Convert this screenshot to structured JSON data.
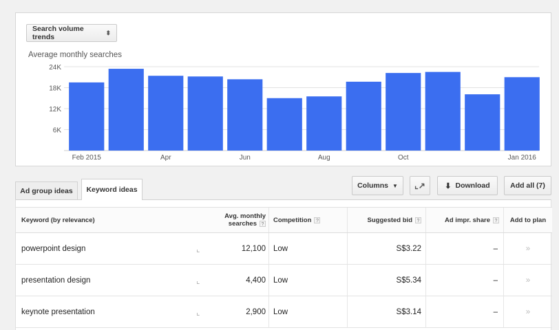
{
  "trend_selector": {
    "label": "Search volume trends",
    "icon": "up-down-arrows-icon"
  },
  "chart_data": {
    "type": "bar",
    "title": "Average monthly searches",
    "categories": [
      "Feb 2015",
      "Mar 2015",
      "Apr 2015",
      "May 2015",
      "Jun 2015",
      "Jul 2015",
      "Aug 2015",
      "Sep 2015",
      "Oct 2015",
      "Nov 2015",
      "Dec 2015",
      "Jan 2016"
    ],
    "x_tick_labels": [
      "Feb 2015",
      "",
      "Apr",
      "",
      "Jun",
      "",
      "Aug",
      "",
      "Oct",
      "",
      "",
      "Jan 2016"
    ],
    "values": [
      19500,
      23400,
      21400,
      21200,
      20400,
      15000,
      15500,
      19700,
      22200,
      22500,
      16100,
      21000
    ],
    "ylim": [
      0,
      24000
    ],
    "y_ticks": [
      6000,
      12000,
      18000,
      24000
    ],
    "y_tick_labels": [
      "6K",
      "12K",
      "18K",
      "24K"
    ],
    "bar_color": "#3b6ef0",
    "grid": true
  },
  "tabs": [
    {
      "label": "Ad group ideas",
      "active": false
    },
    {
      "label": "Keyword ideas",
      "active": true
    }
  ],
  "toolbar": {
    "columns_label": "Columns",
    "download_label": "Download",
    "add_all_label": "Add all (7)"
  },
  "table": {
    "headers": {
      "keyword": "Keyword (by relevance)",
      "avg_line1": "Avg. monthly",
      "avg_line2": "searches",
      "competition": "Competition",
      "suggested_bid": "Suggested bid",
      "ad_impr_share": "Ad impr. share",
      "add_to_plan": "Add to plan"
    },
    "rows": [
      {
        "keyword": "powerpoint design",
        "searches": "12,100",
        "competition": "Low",
        "bid": "S$3.22",
        "impr_share": "–",
        "add": "»"
      },
      {
        "keyword": "presentation design",
        "searches": "4,400",
        "competition": "Low",
        "bid": "S$5.34",
        "impr_share": "–",
        "add": "»"
      },
      {
        "keyword": "keynote presentation",
        "searches": "2,900",
        "competition": "Low",
        "bid": "S$3.14",
        "impr_share": "–",
        "add": "»"
      }
    ]
  },
  "colors": {
    "accent": "#3b6ef0",
    "background": "#f1f1f1"
  }
}
